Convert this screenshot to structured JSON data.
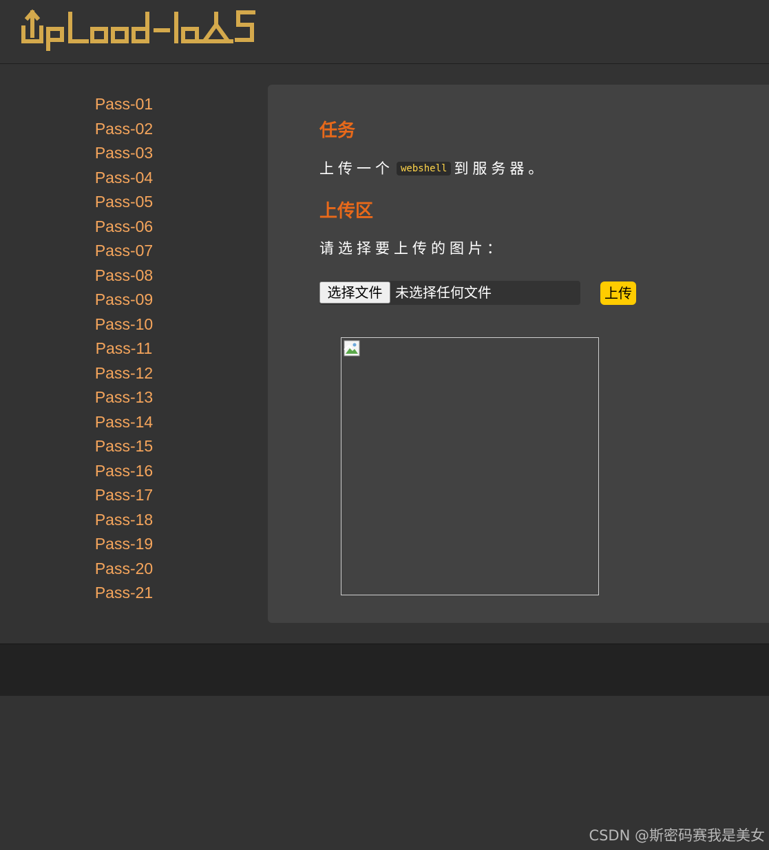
{
  "header": {
    "logo_text": "UpLoad-labS"
  },
  "sidebar": {
    "items": [
      "Pass-01",
      "Pass-02",
      "Pass-03",
      "Pass-04",
      "Pass-05",
      "Pass-06",
      "Pass-07",
      "Pass-08",
      "Pass-09",
      "Pass-10",
      "Pass-11",
      "Pass-12",
      "Pass-13",
      "Pass-14",
      "Pass-15",
      "Pass-16",
      "Pass-17",
      "Pass-18",
      "Pass-19",
      "Pass-20",
      "Pass-21"
    ]
  },
  "main": {
    "task_title": "任务",
    "task_prefix": "上传一个",
    "task_code": "webshell",
    "task_suffix": "到服务器。",
    "upload_title": "上传区",
    "prompt": "请选择要上传的图片：",
    "file_button": "选择文件",
    "file_status": "未选择任何文件",
    "upload_button": "上传"
  },
  "watermark": "CSDN @斯密码赛我是美女",
  "colors": {
    "link": "#f5a55c",
    "heading": "#e8691a",
    "logo": "#d4a94c",
    "upload_button": "#ffcc00"
  }
}
